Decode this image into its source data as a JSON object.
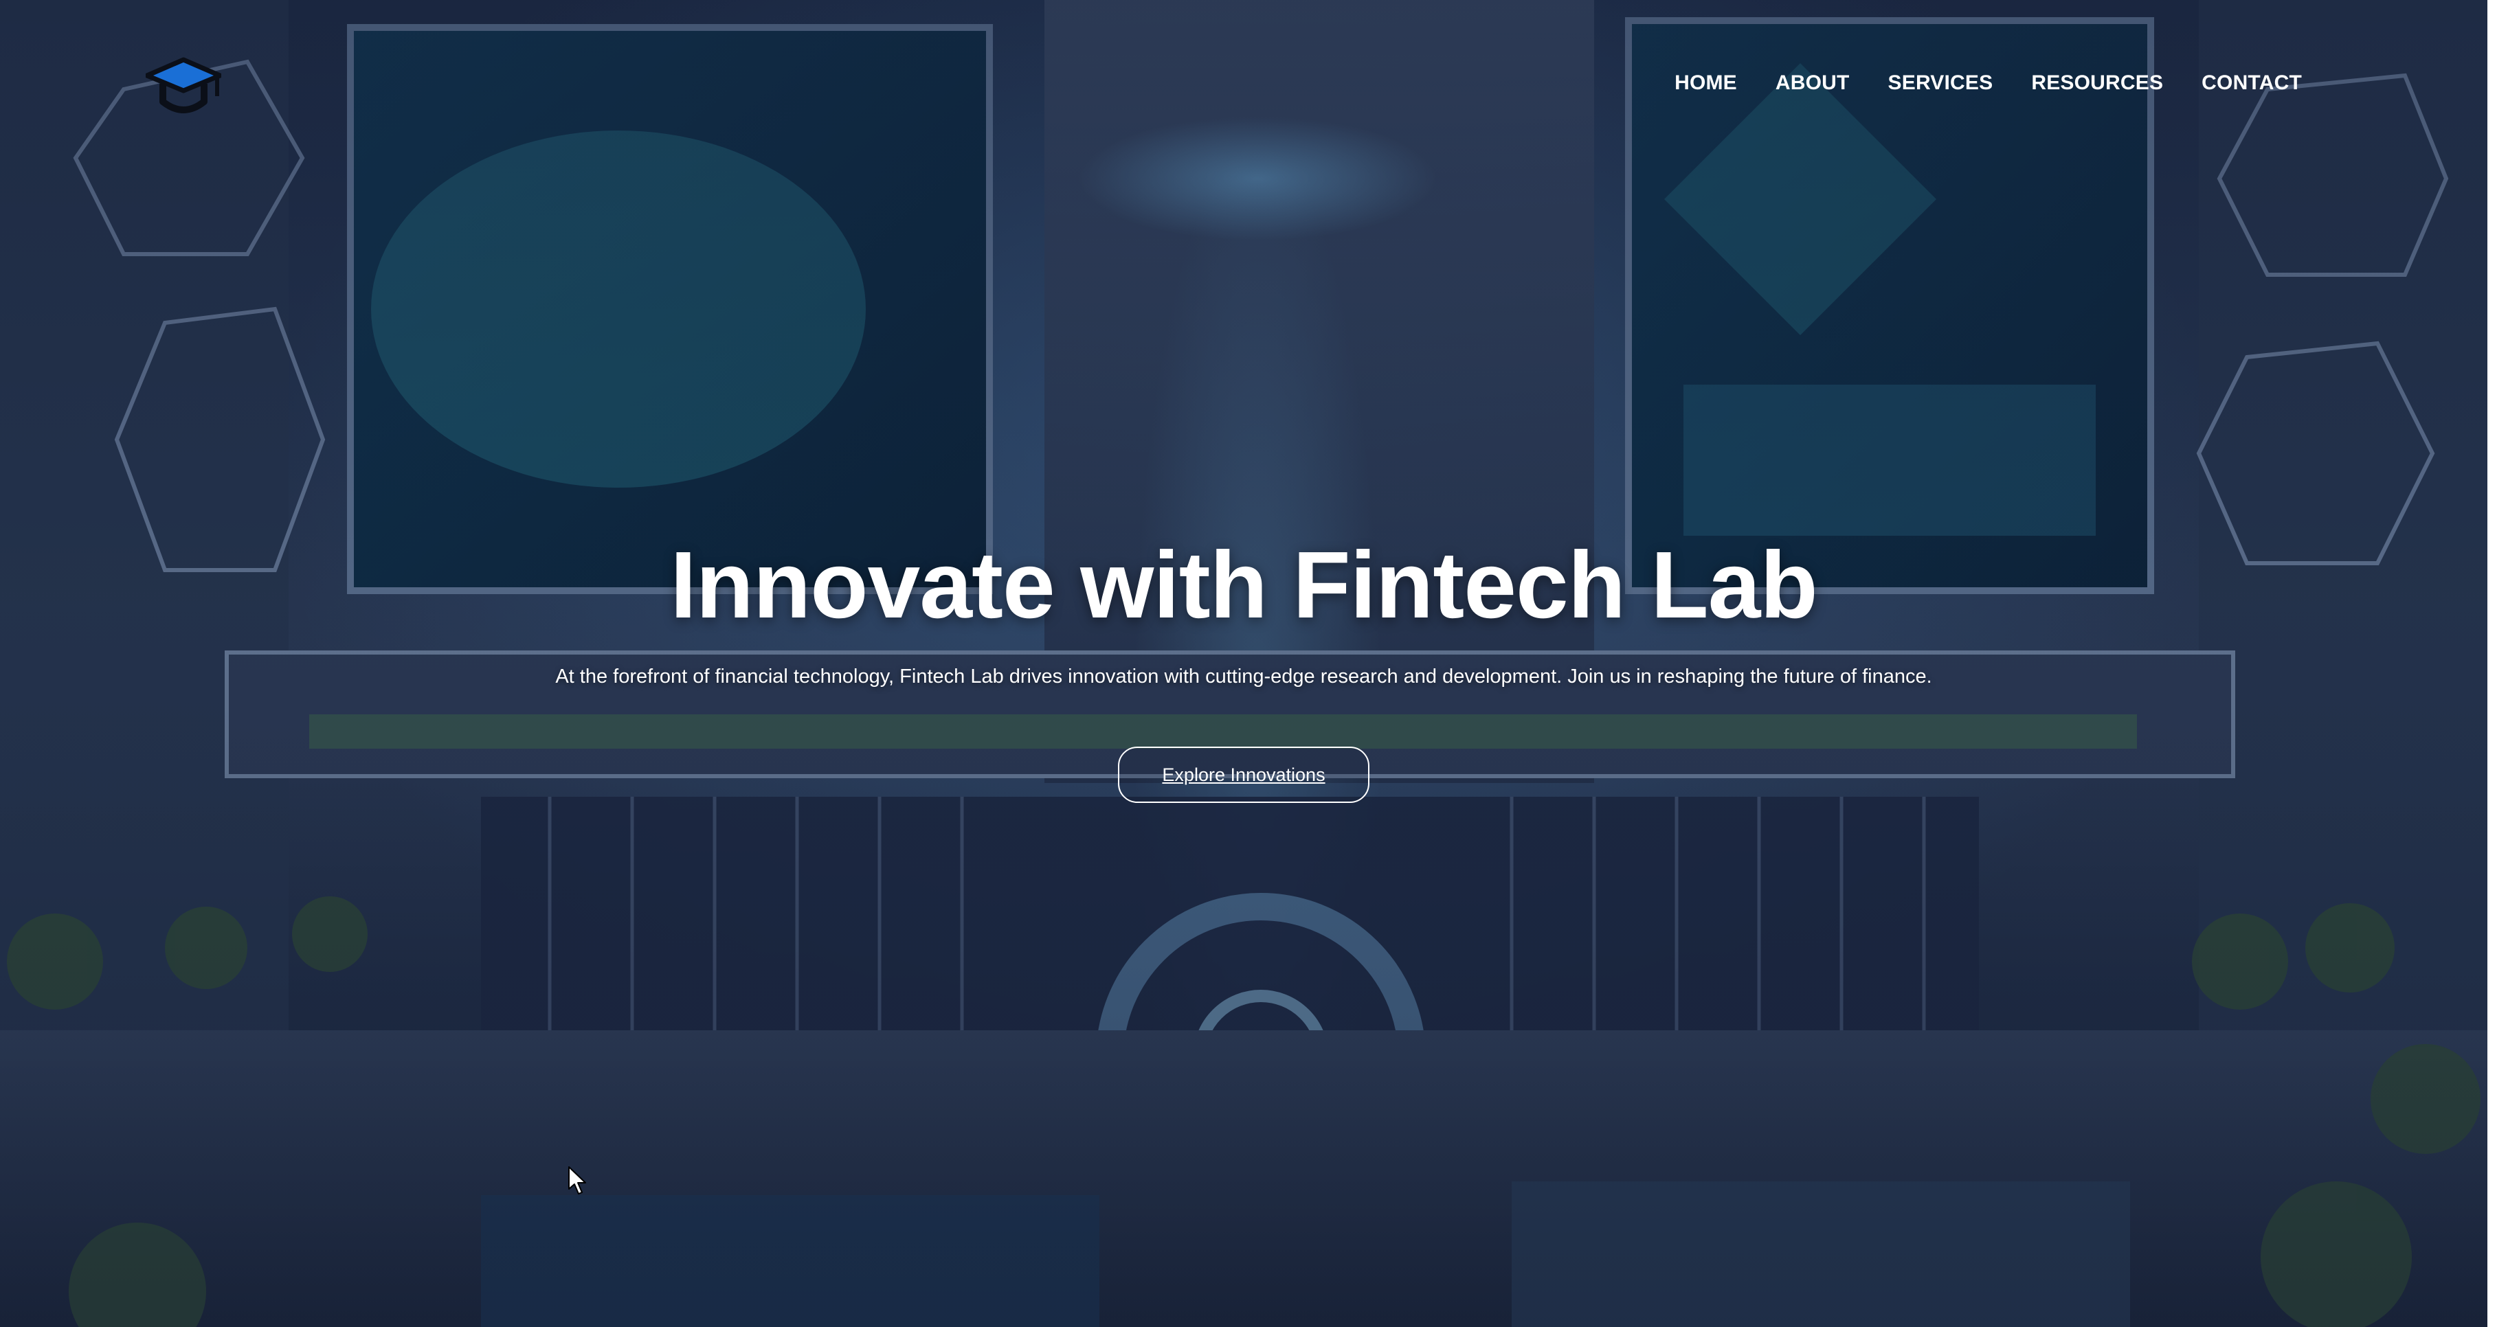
{
  "brand": {
    "logo_icon": "graduation-cap-icon",
    "accent": "#1a6fd6"
  },
  "nav": {
    "items": [
      {
        "label": "HOME"
      },
      {
        "label": "ABOUT"
      },
      {
        "label": "SERVICES"
      },
      {
        "label": "RESOURCES"
      },
      {
        "label": "CONTACT"
      }
    ]
  },
  "hero": {
    "title": "Innovate with Fintech Lab",
    "subtitle": "At the forefront of financial technology, Fintech Lab drives innovation with cutting-edge research and development. Join us in reshaping the future of finance.",
    "cta_label": "Explore Innovations"
  },
  "colors": {
    "text": "#ffffff",
    "background": "#1d2a44"
  }
}
